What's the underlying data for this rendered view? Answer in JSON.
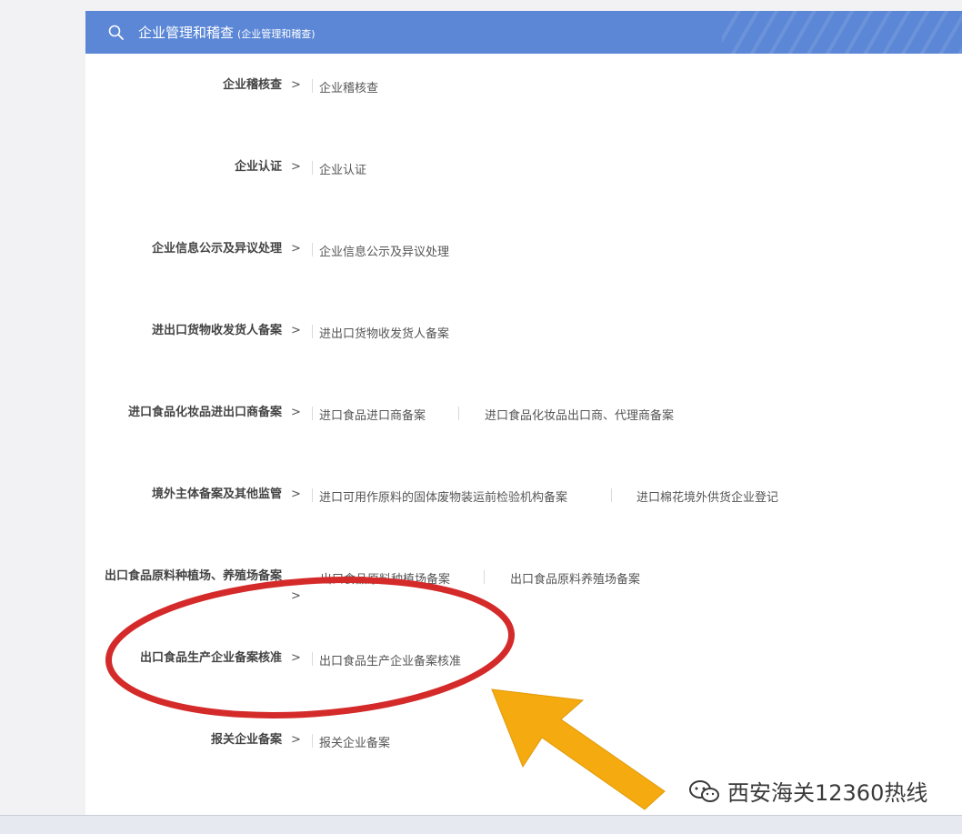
{
  "header": {
    "title": "企业管理和稽查",
    "subtitle": "(企业管理和稽查)"
  },
  "rows": [
    {
      "label": "企业稽核查",
      "arrow": ">",
      "links": [
        "企业稽核查"
      ]
    },
    {
      "label": "企业认证",
      "arrow": ">",
      "links": [
        "企业认证"
      ]
    },
    {
      "label": "企业信息公示及异议处理",
      "arrow": ">",
      "links": [
        "企业信息公示及异议处理"
      ]
    },
    {
      "label": "进出口货物收发货人备案",
      "arrow": ">",
      "links": [
        "进出口货物收发货人备案"
      ]
    },
    {
      "label": "进口食品化妆品进出口商备案",
      "arrow": ">",
      "links": [
        "进口食品进口商备案",
        "进口食品化妆品出口商、代理商备案"
      ]
    },
    {
      "label": "境外主体备案及其他监管",
      "arrow": ">",
      "links": [
        "进口可用作原料的固体废物装运前检验机构备案",
        "进口棉花境外供货企业登记"
      ]
    },
    {
      "label": "出口食品原料种植场、养殖场备案",
      "arrow": ">",
      "links": [
        "出口食品原料种植场备案",
        "出口食品原料养殖场备案"
      ]
    },
    {
      "label": "出口食品生产企业备案核准",
      "arrow": ">",
      "links": [
        "出口食品生产企业备案核准"
      ]
    },
    {
      "label": "报关企业备案",
      "arrow": ">",
      "links": [
        "报关企业备案"
      ]
    }
  ],
  "watermark": {
    "text": "西安海关12360热线",
    "icon": "wechat-icon"
  },
  "colors": {
    "header_bg": "#5b87d6",
    "annotation_circle": "#d42a2a",
    "annotation_arrow": "#f5aa10"
  }
}
